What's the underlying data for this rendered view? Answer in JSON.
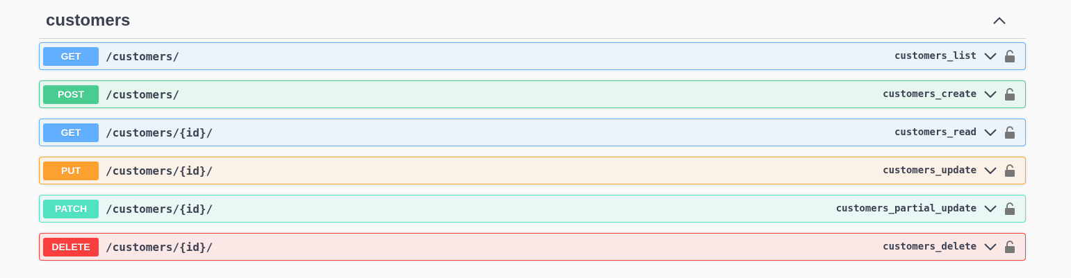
{
  "section": {
    "title": "customers",
    "collapse_icon": "chevron-up-icon"
  },
  "operations": [
    {
      "method": "GET",
      "path": "/customers/",
      "operation_id": "customers_list",
      "color": "#61affe"
    },
    {
      "method": "POST",
      "path": "/customers/",
      "operation_id": "customers_create",
      "color": "#49cc90"
    },
    {
      "method": "GET",
      "path": "/customers/{id}/",
      "operation_id": "customers_read",
      "color": "#61affe"
    },
    {
      "method": "PUT",
      "path": "/customers/{id}/",
      "operation_id": "customers_update",
      "color": "#fca130"
    },
    {
      "method": "PATCH",
      "path": "/customers/{id}/",
      "operation_id": "customers_partial_update",
      "color": "#50e3c2"
    },
    {
      "method": "DELETE",
      "path": "/customers/{id}/",
      "operation_id": "customers_delete",
      "color": "#f93e3e"
    }
  ],
  "icons": {
    "expand": "chevron-down-icon",
    "auth": "lock-icon"
  }
}
